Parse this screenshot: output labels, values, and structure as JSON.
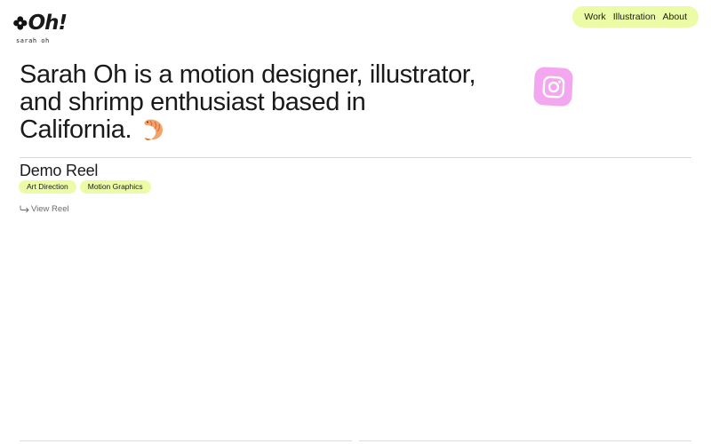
{
  "brand": {
    "logo_text": "Oh!",
    "logo_sub": "sarah oh"
  },
  "nav": {
    "items": [
      {
        "label": "Work"
      },
      {
        "label": "Illustration"
      },
      {
        "label": "About"
      }
    ],
    "background": "#ecfca6"
  },
  "hero": {
    "headline": "Sarah Oh is a motion designer, illustrator, and shrimp enthusiast based in California.",
    "emoji_icon": "shrimp-icon"
  },
  "social": {
    "icon": "instagram-icon",
    "color": "#f2a7f0"
  },
  "project": {
    "title": "Demo Reel",
    "tags": [
      "Art Direction",
      "Motion Graphics"
    ],
    "link_label": "View Reel",
    "link_icon": "arrow-right-icon"
  },
  "colors": {
    "accent": "#ecfca6",
    "text": "#1a1a1a",
    "muted": "#6b6b6b",
    "rule": "#d9d9d9"
  }
}
